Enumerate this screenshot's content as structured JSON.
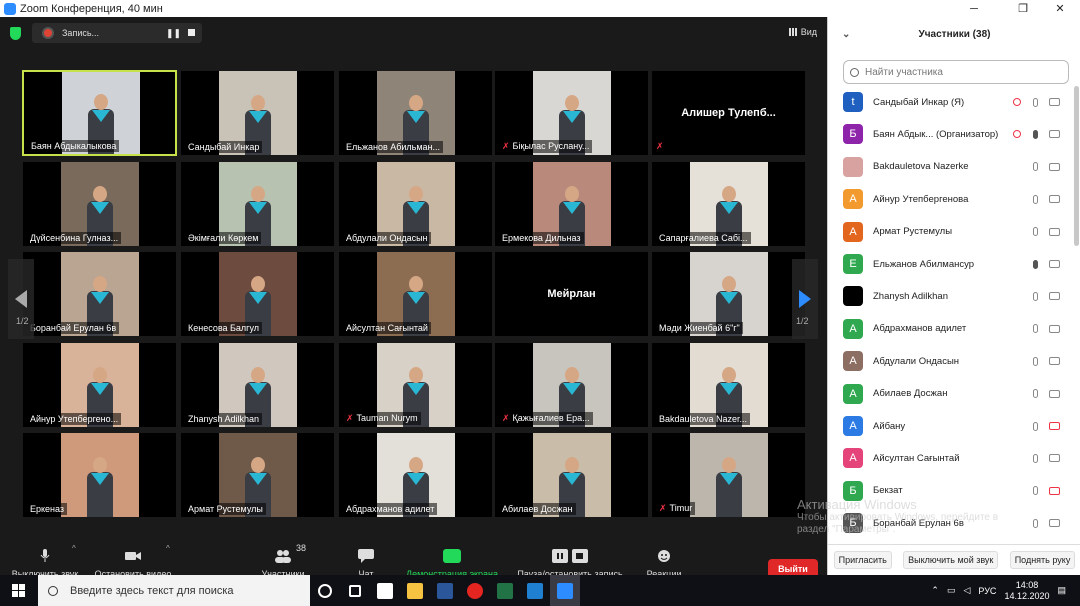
{
  "window": {
    "title": "Zoom Конференция, 40 мин",
    "minimize": "─",
    "maximize": "❐",
    "close": "✕"
  },
  "topbar": {
    "recording_label": "Запись...",
    "pause_glyph": "❚❚",
    "view_label": "Вид"
  },
  "tiles": [
    {
      "name": "Баян Абдыкалыкова",
      "muted": false,
      "active": true,
      "video": true,
      "bg": "#cfd3d8"
    },
    {
      "name": "Сандыбай Инкар",
      "muted": false,
      "active": false,
      "video": true,
      "bg": "#c9c2b6"
    },
    {
      "name": "Ельжанов Абильман...",
      "muted": false,
      "active": false,
      "video": true,
      "bg": "#8f8478"
    },
    {
      "name": "Бiқылас Руслану...",
      "muted": true,
      "active": false,
      "video": true,
      "bg": "#d9d7d3"
    },
    {
      "name": "Алишер Тулепб...",
      "muted": true,
      "active": false,
      "video": false,
      "bg": "#000000"
    },
    {
      "name": "Дүйсенбина Гулназ...",
      "muted": false,
      "active": false,
      "video": true,
      "bg": "#7a6a5c"
    },
    {
      "name": "Әкімғали Көркем",
      "muted": false,
      "active": false,
      "video": true,
      "bg": "#b7c2b0"
    },
    {
      "name": "Абдулали Ондасын",
      "muted": false,
      "active": false,
      "video": true,
      "bg": "#c9b9a4"
    },
    {
      "name": "Ермекова Дильназ",
      "muted": false,
      "active": false,
      "video": true,
      "bg": "#b98a7c"
    },
    {
      "name": "Сапарғалиева Сабі...",
      "muted": false,
      "active": false,
      "video": true,
      "bg": "#e6e1d8"
    },
    {
      "name": "Боранбай Ерулан 6в",
      "muted": false,
      "active": false,
      "video": true,
      "bg": "#b9a592"
    },
    {
      "name": "Кенесова Балгул",
      "muted": false,
      "active": false,
      "video": true,
      "bg": "#6d4b3e"
    },
    {
      "name": "Айсултан Сағынтай",
      "muted": false,
      "active": false,
      "video": true,
      "bg": "#8c6d52"
    },
    {
      "name": "Мейрлан",
      "muted": false,
      "active": false,
      "video": false,
      "bg": "#000000"
    },
    {
      "name": "Мәди Жиенбай 6\"г\"",
      "muted": false,
      "active": false,
      "video": true,
      "bg": "#d7d4d0"
    },
    {
      "name": "Айнур Утепбергено...",
      "muted": false,
      "active": false,
      "video": true,
      "bg": "#d9b29a"
    },
    {
      "name": "Zhanysh Adilkhan",
      "muted": false,
      "active": false,
      "video": true,
      "bg": "#d0c8bf"
    },
    {
      "name": "Tauman Nurym",
      "muted": true,
      "active": false,
      "video": true,
      "bg": "#d8d1c7"
    },
    {
      "name": "Қажығалиев Ера...",
      "muted": true,
      "active": false,
      "video": true,
      "bg": "#c7c5bd"
    },
    {
      "name": "Bakdauletova Nazer...",
      "muted": false,
      "active": false,
      "video": true,
      "bg": "#e2dcd2"
    },
    {
      "name": "Еркеназ",
      "muted": false,
      "active": false,
      "video": true,
      "bg": "#cf9a7c"
    },
    {
      "name": "Армат Рустемулы",
      "muted": false,
      "active": false,
      "video": true,
      "bg": "#6f5a49"
    },
    {
      "name": "Абдрахманов адилет",
      "muted": false,
      "active": false,
      "video": true,
      "bg": "#e3e0da"
    },
    {
      "name": "Абилаев Досжан",
      "muted": false,
      "active": false,
      "video": true,
      "bg": "#c9bca9"
    },
    {
      "name": "Timur",
      "muted": true,
      "active": false,
      "video": true,
      "bg": "#bdb6ad"
    }
  ],
  "pagination": {
    "left_page": "1/2",
    "right_page": "1/2"
  },
  "toolbar": {
    "mute": "Выключить звук",
    "video": "Остановить видео",
    "participants": "Участники",
    "participants_count": "38",
    "chat": "Чат",
    "share": "Демонстрация экрана",
    "record": "Пауза/остановить запись",
    "reactions": "Реакции",
    "end": "Выйти"
  },
  "panel": {
    "title": "Участники (38)",
    "search_placeholder": "Найти участника",
    "participants": [
      {
        "name": "Сандыбай Инкар (Я)",
        "initial": "t",
        "color": "#1f5fbf",
        "rec": true,
        "mic_active": false,
        "cam_off": false
      },
      {
        "name": "Баян Абдык... (Организатор)",
        "initial": "Б",
        "color": "#8e24aa",
        "rec": true,
        "mic_active": true,
        "cam_off": false
      },
      {
        "name": "Bakdauletova Nazerke",
        "initial": "",
        "color": "#d8a2a0",
        "rec": false,
        "mic_active": false,
        "cam_off": false
      },
      {
        "name": "Айнур Утепбергенова",
        "initial": "А",
        "color": "#f29a2e",
        "rec": false,
        "mic_active": false,
        "cam_off": false
      },
      {
        "name": "Армат Рустемулы",
        "initial": "А",
        "color": "#e2661e",
        "rec": false,
        "mic_active": false,
        "cam_off": false
      },
      {
        "name": "Ельжанов Абилмансур",
        "initial": "Е",
        "color": "#2fa84f",
        "rec": false,
        "mic_active": true,
        "cam_off": false
      },
      {
        "name": "Zhanysh Adilkhan",
        "initial": "",
        "color": "#000000",
        "rec": false,
        "mic_active": false,
        "cam_off": false
      },
      {
        "name": "Абдрахманов адилет",
        "initial": "А",
        "color": "#2fa84f",
        "rec": false,
        "mic_active": false,
        "cam_off": false
      },
      {
        "name": "Абдулали Ондасын",
        "initial": "А",
        "color": "#8d6e63",
        "rec": false,
        "mic_active": false,
        "cam_off": false
      },
      {
        "name": "Абилаев Досжан",
        "initial": "А",
        "color": "#2fa84f",
        "rec": false,
        "mic_active": false,
        "cam_off": false
      },
      {
        "name": "Айбану",
        "initial": "А",
        "color": "#2c7be5",
        "rec": false,
        "mic_active": false,
        "cam_off": true
      },
      {
        "name": "Айсултан Сағынтай",
        "initial": "А",
        "color": "#e5447a",
        "rec": false,
        "mic_active": false,
        "cam_off": false
      },
      {
        "name": "Бекзат",
        "initial": "Б",
        "color": "#2fa84f",
        "rec": false,
        "mic_active": false,
        "cam_off": true
      },
      {
        "name": "Боранбай Ерулан 6в",
        "initial": "Б",
        "color": "#555555",
        "rec": false,
        "mic_active": false,
        "cam_off": false
      }
    ],
    "footer": {
      "invite": "Пригласить",
      "mute_all": "Выключить мой звук",
      "raise_hand": "Поднять руку"
    }
  },
  "watermark": {
    "title": "Активация Windows",
    "line1": "Чтобы активировать Windows, перейдите в",
    "line2": "раздел \"Параметры\"."
  },
  "taskbar": {
    "search_placeholder": "Введите здесь текст для поиска",
    "lang": "РУС",
    "time": "14:08",
    "date": "14.12.2020"
  }
}
